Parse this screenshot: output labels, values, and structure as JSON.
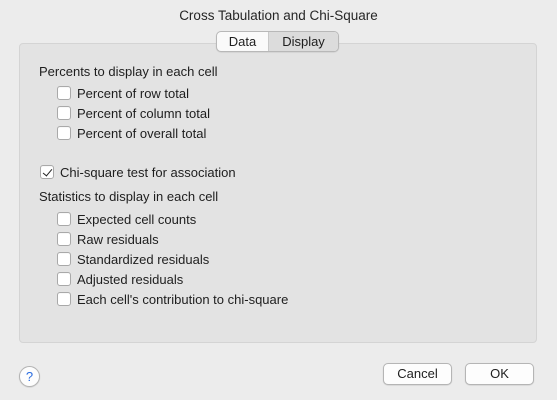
{
  "window": {
    "title": "Cross Tabulation and Chi-Square"
  },
  "tabs": [
    {
      "label": "Data",
      "active": false
    },
    {
      "label": "Display",
      "active": true
    }
  ],
  "percents": {
    "heading": "Percents to display in each cell",
    "options": [
      {
        "label": "Percent of row total",
        "checked": false
      },
      {
        "label": "Percent of column total",
        "checked": false
      },
      {
        "label": "Percent of overall total",
        "checked": false
      }
    ]
  },
  "chi_square": {
    "label": "Chi-square test for association",
    "checked": true
  },
  "statistics": {
    "heading": "Statistics to display in each cell",
    "options": [
      {
        "label": "Expected cell counts",
        "checked": false
      },
      {
        "label": "Raw residuals",
        "checked": false
      },
      {
        "label": "Standardized residuals",
        "checked": false
      },
      {
        "label": "Adjusted residuals",
        "checked": false
      },
      {
        "label": "Each cell's contribution to chi-square",
        "checked": false
      }
    ]
  },
  "footer": {
    "help_label": "?",
    "cancel_label": "Cancel",
    "ok_label": "OK"
  },
  "icons": {
    "help": "help-icon",
    "checkbox": "checkbox-icon",
    "checkmark": "checkmark-icon"
  }
}
